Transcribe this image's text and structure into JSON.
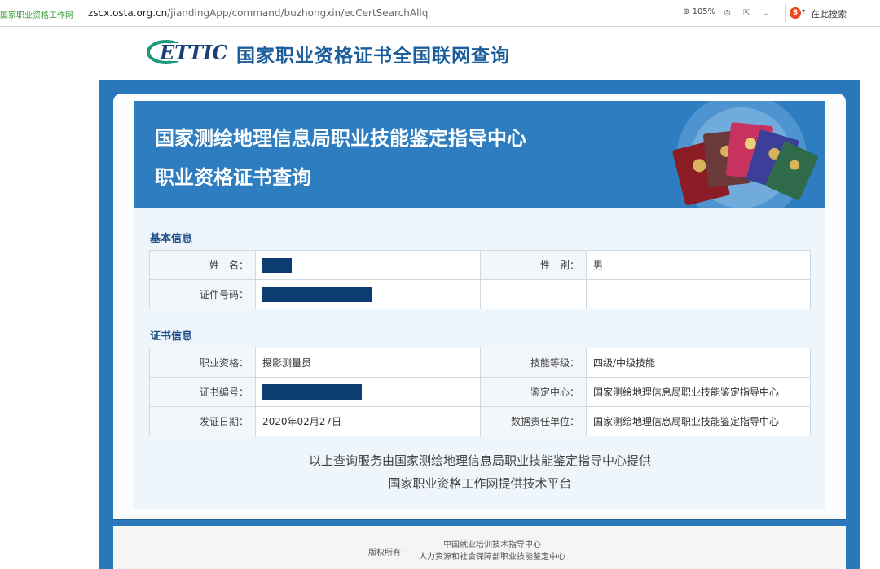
{
  "browser": {
    "tab_title": "国家职业资格工作网",
    "url_host": "zscx.osta.org.cn",
    "url_path": "/jiandingApp/command/buzhongxin/ecCertSearchAllq",
    "zoom": "105%",
    "search_placeholder": "在此搜索",
    "search_logo": "S"
  },
  "header": {
    "logo_text": "ETTIC",
    "title": "国家职业资格证书全国联网查询"
  },
  "banner": {
    "line1": "国家测绘地理信息局职业技能鉴定指导中心",
    "line2": "职业资格证书查询"
  },
  "basic_info": {
    "section_title": "基本信息",
    "name_label": "姓　名：",
    "gender_label": "性　别：",
    "gender_value": "男",
    "id_label": "证件号码："
  },
  "cert_info": {
    "section_title": "证书信息",
    "qualification_label": "职业资格：",
    "qualification_value": "摄影测量员",
    "skill_level_label": "技能等级：",
    "skill_level_value": "四级/中级技能",
    "cert_no_label": "证书编号：",
    "center_label": "鉴定中心：",
    "center_value": "国家测绘地理信息局职业技能鉴定指导中心",
    "issue_date_label": "发证日期：",
    "issue_date_value": "2020年02月27日",
    "data_unit_label": "数据责任单位：",
    "data_unit_value": "国家测绘地理信息局职业技能鉴定指导中心"
  },
  "credits": {
    "line1": "以上查询服务由国家测绘地理信息局职业技能鉴定指导中心提供",
    "line2": "国家职业资格工作网提供技术平台"
  },
  "footer": {
    "copyright_label": "版权所有：",
    "org1": "中国就业培训技术指导中心",
    "org2": "人力资源和社会保障部职业技能鉴定中心"
  },
  "colors": {
    "brand_blue": "#2b77bb",
    "banner_blue": "#2e7dc1",
    "title_blue": "#1b5e9b",
    "redaction": "#0c3c72"
  }
}
